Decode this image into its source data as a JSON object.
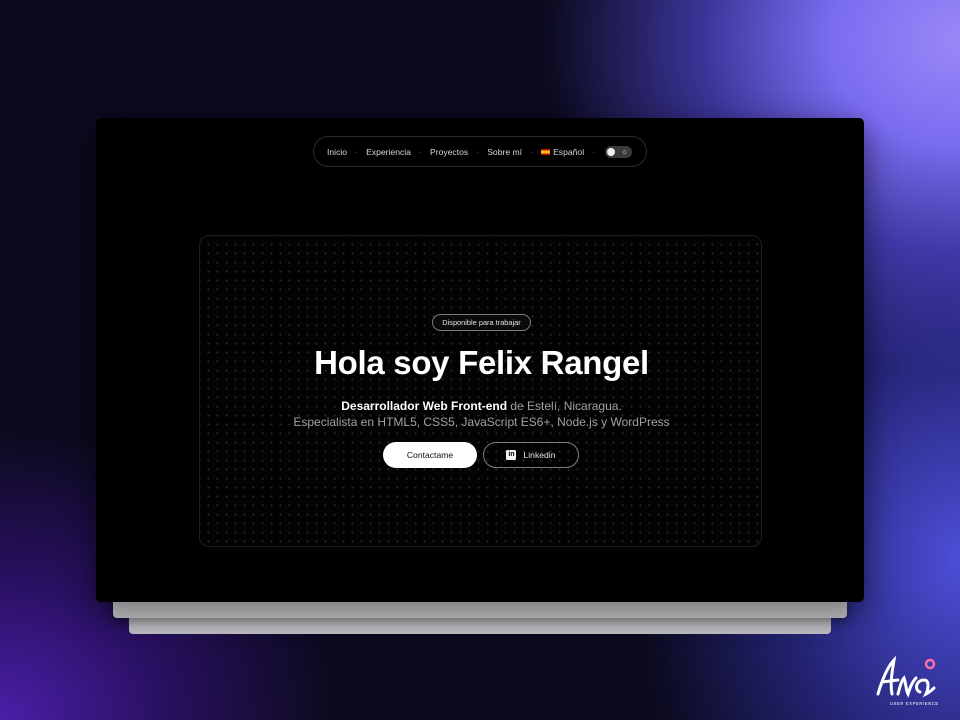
{
  "nav": {
    "items": [
      "Inicio",
      "Experiencia",
      "Proyectos",
      "Sobre mí"
    ],
    "language": "Español",
    "separator": "·"
  },
  "hero": {
    "badge": "Disponible para trabajar",
    "title": "Hola soy Felix Rangel",
    "role": "Desarrollador Web Front-end",
    "location": " de Estelí, Nicaragua.",
    "specialty": "Especialista en HTML5, CSS5, JavaScript ES6+, Node.js y WordPress",
    "primary_button": "Contactame",
    "secondary_button": "Linkedin"
  },
  "logo": {
    "text": "Ana",
    "tagline": "USER EXPERIENCE"
  },
  "colors": {
    "window_bg": "#000000",
    "accent_purple": "#7a6cf0",
    "button_primary_bg": "#ffffff"
  }
}
